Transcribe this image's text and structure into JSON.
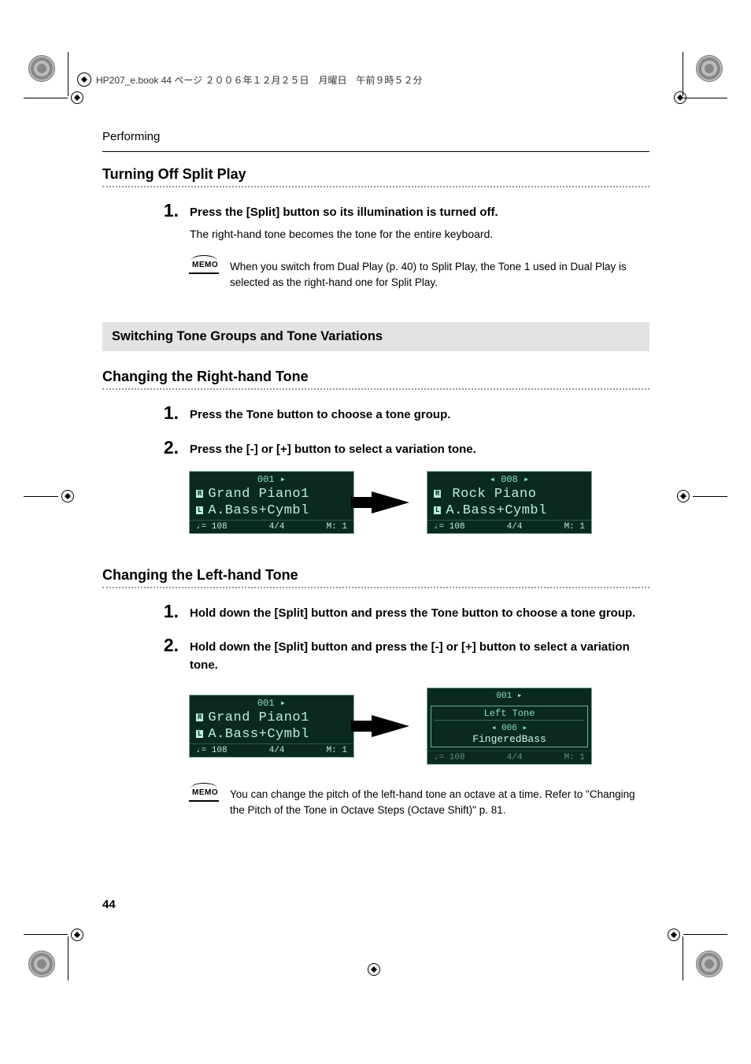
{
  "header": {
    "print_info": "HP207_e.book 44 ページ ２００６年１２月２５日　月曜日　午前９時５２分"
  },
  "page": {
    "section_label": "Performing",
    "number": "44"
  },
  "sec1": {
    "title": "Turning Off Split Play",
    "step1_num": "1.",
    "step1_bold": "Press the [Split] button so its illumination is turned off.",
    "step1_sub": "The right-hand tone becomes the tone for the entire keyboard.",
    "memo_label": "MEMO",
    "memo_text": "When you switch from Dual Play (p. 40) to Split Play, the Tone 1 used in Dual Play is selected as the right-hand one for Split Play."
  },
  "sec2": {
    "band_title": "Switching Tone Groups and Tone Variations"
  },
  "sec3": {
    "title": "Changing the Right-hand Tone",
    "step1_num": "1.",
    "step1_bold": "Press the Tone button to choose a tone group.",
    "step2_num": "2.",
    "step2_bold": "Press the [-] or [+] button to select a variation tone.",
    "lcd1": {
      "top": "001 ▸",
      "tag_r": "R",
      "line_r": "Grand Piano1",
      "tag_l": "L",
      "line_l": "A.Bass+Cymbl",
      "status_l": "♩= 108",
      "status_m": "4/4",
      "status_r": "M:   1"
    },
    "lcd2": {
      "top": "◂ 008 ▸",
      "tag_r": "R",
      "line_r": "Rock Piano",
      "tag_l": "L",
      "line_l": "A.Bass+Cymbl",
      "status_l": "♩= 108",
      "status_m": "4/4",
      "status_r": "M:   1"
    }
  },
  "sec4": {
    "title": "Changing the Left-hand Tone",
    "step1_num": "1.",
    "step1_bold": "Hold down the [Split] button and press the Tone button to choose a tone group.",
    "step2_num": "2.",
    "step2_bold": "Hold down the [Split] button and press the [-] or [+] button to select a variation tone.",
    "lcd1": {
      "top": "001 ▸",
      "tag_r": "R",
      "line_r": "Grand Piano1",
      "tag_l": "L",
      "line_l": "A.Bass+Cymbl",
      "status_l": "♩= 108",
      "status_m": "4/4",
      "status_r": "M:   1"
    },
    "lcd2": {
      "outer_top": "001 ▸",
      "inner_title": "Left Tone",
      "inner_sel": "◂ 006 ▸",
      "inner_val": "FingeredBass",
      "status_l": "♩= 108",
      "status_m": "4/4",
      "status_r": "M:   1"
    },
    "memo_label": "MEMO",
    "memo_text": "You can change the pitch of the left-hand tone an octave at a time. Refer to \"Changing the Pitch of the Tone in Octave Steps (Octave Shift)\" p. 81."
  }
}
